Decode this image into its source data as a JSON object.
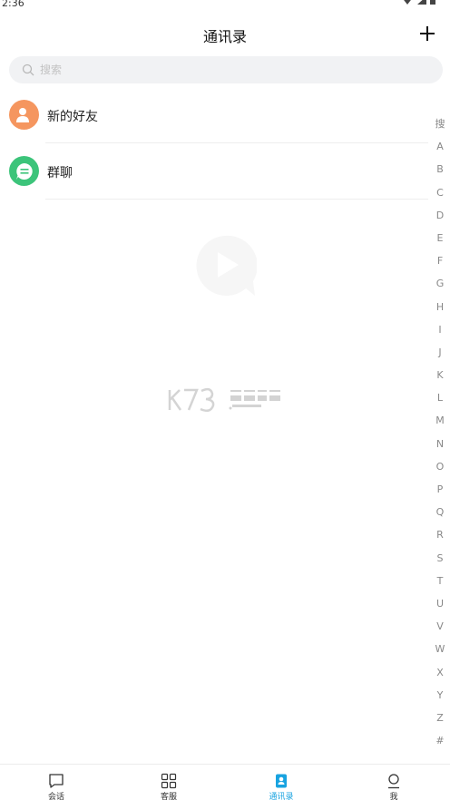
{
  "status_bar": {
    "time": "2:36"
  },
  "header": {
    "title": "通讯录"
  },
  "search": {
    "placeholder": "搜索"
  },
  "list": [
    {
      "label": "新的好友",
      "color": "#f5965f"
    },
    {
      "label": "群聊",
      "color": "#3cc47a"
    }
  ],
  "alpha_index": [
    "搜",
    "A",
    "B",
    "C",
    "D",
    "E",
    "F",
    "G",
    "H",
    "I",
    "J",
    "K",
    "L",
    "M",
    "N",
    "O",
    "P",
    "Q",
    "R",
    "S",
    "T",
    "U",
    "V",
    "W",
    "X",
    "Y",
    "Z",
    "#"
  ],
  "tabs": [
    {
      "label": "会话",
      "icon": "chat-icon",
      "active": false
    },
    {
      "label": "客服",
      "icon": "grid-icon",
      "active": false
    },
    {
      "label": "通讯录",
      "icon": "contacts-icon",
      "active": true
    },
    {
      "label": "我",
      "icon": "profile-icon",
      "active": false
    }
  ],
  "colors": {
    "accent": "#18a3e0"
  }
}
